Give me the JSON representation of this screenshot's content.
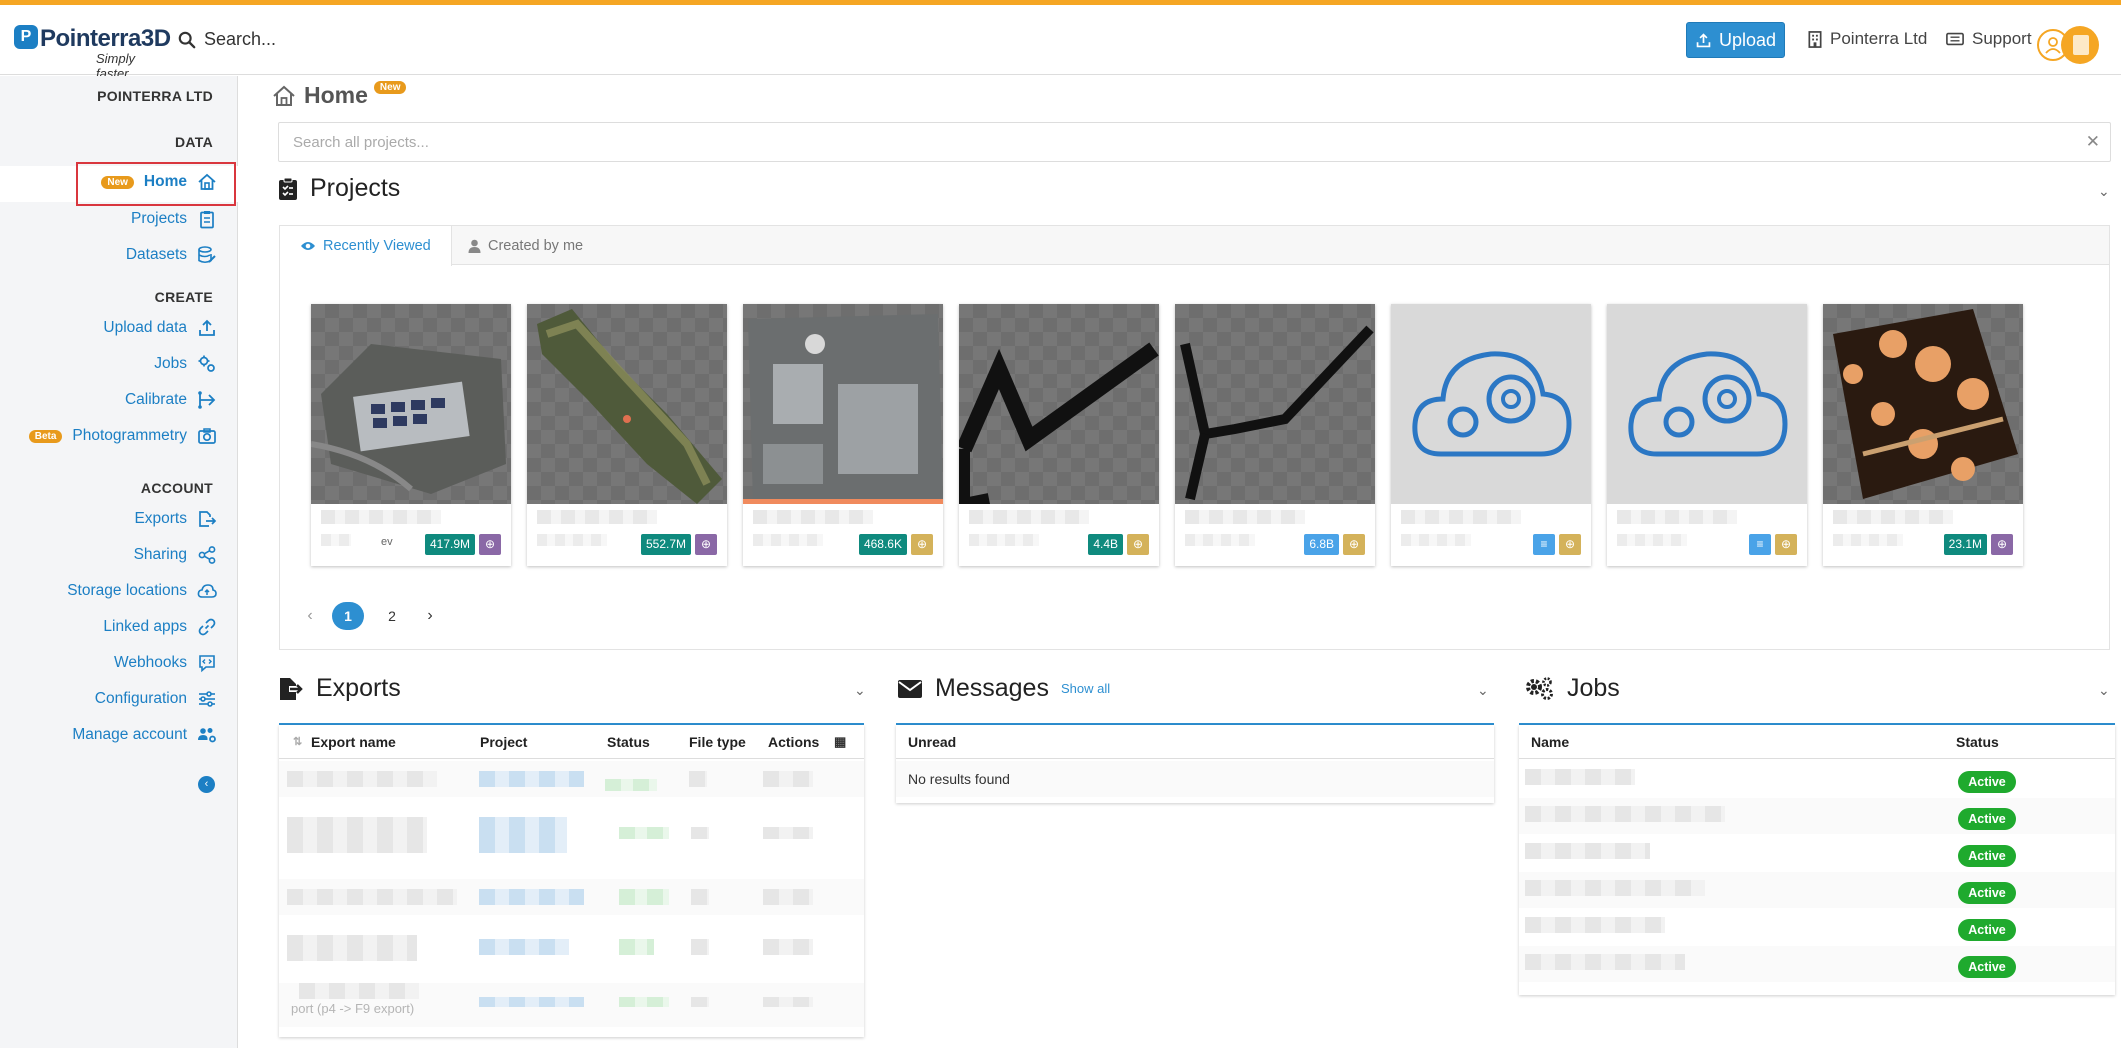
{
  "topbar": {
    "logo_text": "Pointerra3D",
    "logo_tagline": "Simply faster.",
    "search_placeholder": "Search...",
    "upload_label": "Upload",
    "org_label": "Pointerra Ltd",
    "support_label": "Support"
  },
  "sidebar": {
    "org_name": "POINTERRA LTD",
    "sections": {
      "data": "DATA",
      "create": "CREATE",
      "account": "ACCOUNT"
    },
    "items": {
      "home": {
        "label": "Home",
        "badge": "New"
      },
      "projects": {
        "label": "Projects"
      },
      "datasets": {
        "label": "Datasets"
      },
      "upload_data": {
        "label": "Upload data"
      },
      "jobs": {
        "label": "Jobs"
      },
      "calibrate": {
        "label": "Calibrate"
      },
      "photogrammetry": {
        "label": "Photogrammetry",
        "badge": "Beta"
      },
      "exports": {
        "label": "Exports"
      },
      "sharing": {
        "label": "Sharing"
      },
      "storage_locations": {
        "label": "Storage locations"
      },
      "linked_apps": {
        "label": "Linked apps"
      },
      "webhooks": {
        "label": "Webhooks"
      },
      "configuration": {
        "label": "Configuration"
      },
      "manage_account": {
        "label": "Manage account"
      }
    }
  },
  "main": {
    "page_title": "Home",
    "page_badge": "New",
    "search_all_placeholder": "Search all projects...",
    "projects": {
      "title": "Projects",
      "tabs": [
        {
          "label": "Recently Viewed"
        },
        {
          "label": "Created by me"
        }
      ],
      "cards": [
        {
          "size": "417.9M",
          "sub": "ev",
          "icon": "globe-icon",
          "icon_color": "purple"
        },
        {
          "size": "552.7M",
          "sub": "",
          "icon": "globe-icon",
          "icon_color": "purple"
        },
        {
          "size": "468.6K",
          "sub": "",
          "icon": "globe-icon",
          "icon_color": "gold"
        },
        {
          "size": "4.4B",
          "sub": "",
          "icon": "globe-icon",
          "icon_color": "gold"
        },
        {
          "size": "6.8B",
          "sub": "",
          "icon": "globe-icon",
          "icon_color": "gold"
        },
        {
          "size": "",
          "sub": "",
          "icon": "globe-icon",
          "icon_color": "gold"
        },
        {
          "size": "",
          "sub": "",
          "icon": "globe-icon",
          "icon_color": "gold"
        },
        {
          "size": "23.1M",
          "sub": "",
          "icon": "globe-icon",
          "icon_color": "purple"
        }
      ],
      "pagination": {
        "pages": [
          "1",
          "2"
        ],
        "current": "1"
      }
    },
    "exports": {
      "title": "Exports",
      "columns": [
        "Export name",
        "Project",
        "Status",
        "File type",
        "Actions"
      ],
      "last_row_text": "port (p4 -> F9 export)"
    },
    "messages": {
      "title": "Messages",
      "show_all": "Show all",
      "column": "Unread",
      "empty_text": "No results found"
    },
    "jobs": {
      "title": "Jobs",
      "columns": [
        "Name",
        "Status"
      ],
      "statuses": [
        "Active",
        "Active",
        "Active",
        "Active",
        "Active",
        "Active"
      ]
    }
  }
}
